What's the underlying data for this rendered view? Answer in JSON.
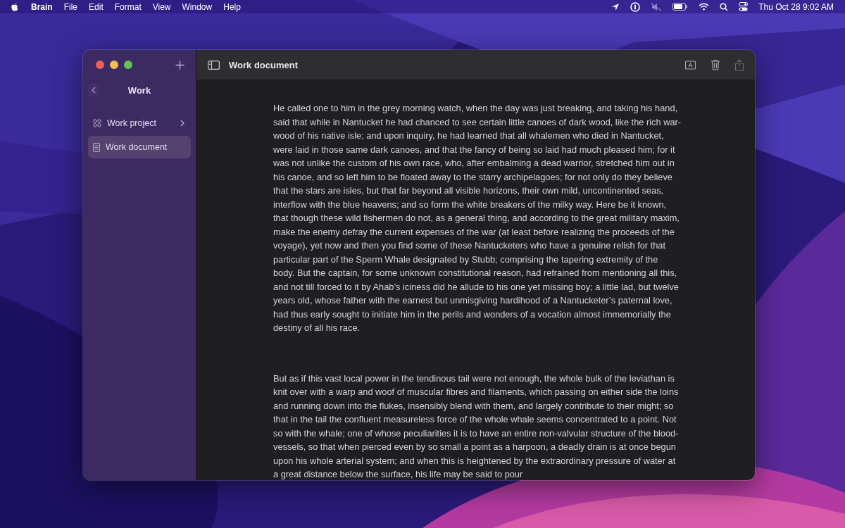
{
  "menu_bar": {
    "app_name": "Brain",
    "menus": [
      "File",
      "Edit",
      "Format",
      "View",
      "Window",
      "Help"
    ],
    "clock": "Thu Oct 28  9:02 AM"
  },
  "sidebar": {
    "title": "Work",
    "items": [
      {
        "label": "Work project",
        "kind": "group",
        "selected": false
      },
      {
        "label": "Work document",
        "kind": "document",
        "selected": true
      }
    ]
  },
  "toolbar": {
    "title": "Work document"
  },
  "document": {
    "paragraphs": [
      "He called one to him in the grey morning watch, when the day was just breaking, and taking his hand, said that while in Nantucket he had chanced to see certain little canoes of dark wood, like the rich war-wood of his native isle; and upon inquiry, he had learned that all whalemen who died in Nantucket, were laid in those same dark canoes, and that the fancy of being so laid had much pleased him; for it was not unlike the custom of his own race, who, after embalming a dead warrior, stretched him out in his canoe, and so left him to be floated away to the starry archipelagoes; for not only do they believe that the stars are isles, but that far beyond all visible horizons, their own mild, uncontinented seas, interflow with the blue heavens; and so form the white breakers of the milky way. Here be it known, that though these wild fishermen do not, as a general thing, and according to the great military maxim, make the enemy defray the current expenses of the war (at least before realizing the proceeds of the voyage), yet now and then you find some of these Nantucketers who have a genuine relish for that particular part of the Sperm Whale designated by Stubb; comprising the tapering extremity of the body. But the captain, for some unknown constitutional reason, had refrained from mentioning all this, and not till forced to it by Ahab’s iciness did he allude to his one yet missing boy; a little lad, but twelve years old, whose father with the earnest but unmisgiving hardihood of a Nantucketer’s paternal love, had thus early sought to initiate him in the perils and wonders of a vocation almost immemorially the destiny of all his race.",
      "But as if this vast local power in the tendinous tail were not enough, the whole bulk of the leviathan is knit over with a warp and woof of muscular fibres and filaments, which passing on either side the loins and running down into the flukes, insensibly blend with them, and largely contribute to their might; so that in the tail the confluent measureless force of the whole whale seems concentrated to a point. Not so with the whale; one of whose peculiarities it is to have an entire non-valvular structure of the blood-vessels, so that when pierced even by so small a point as a harpoon, a deadly drain is at once begun upon his whole arterial system; and when this is heightened by the extraordinary pressure of water at a great distance below the surface, his life may be said to pour"
    ]
  }
}
